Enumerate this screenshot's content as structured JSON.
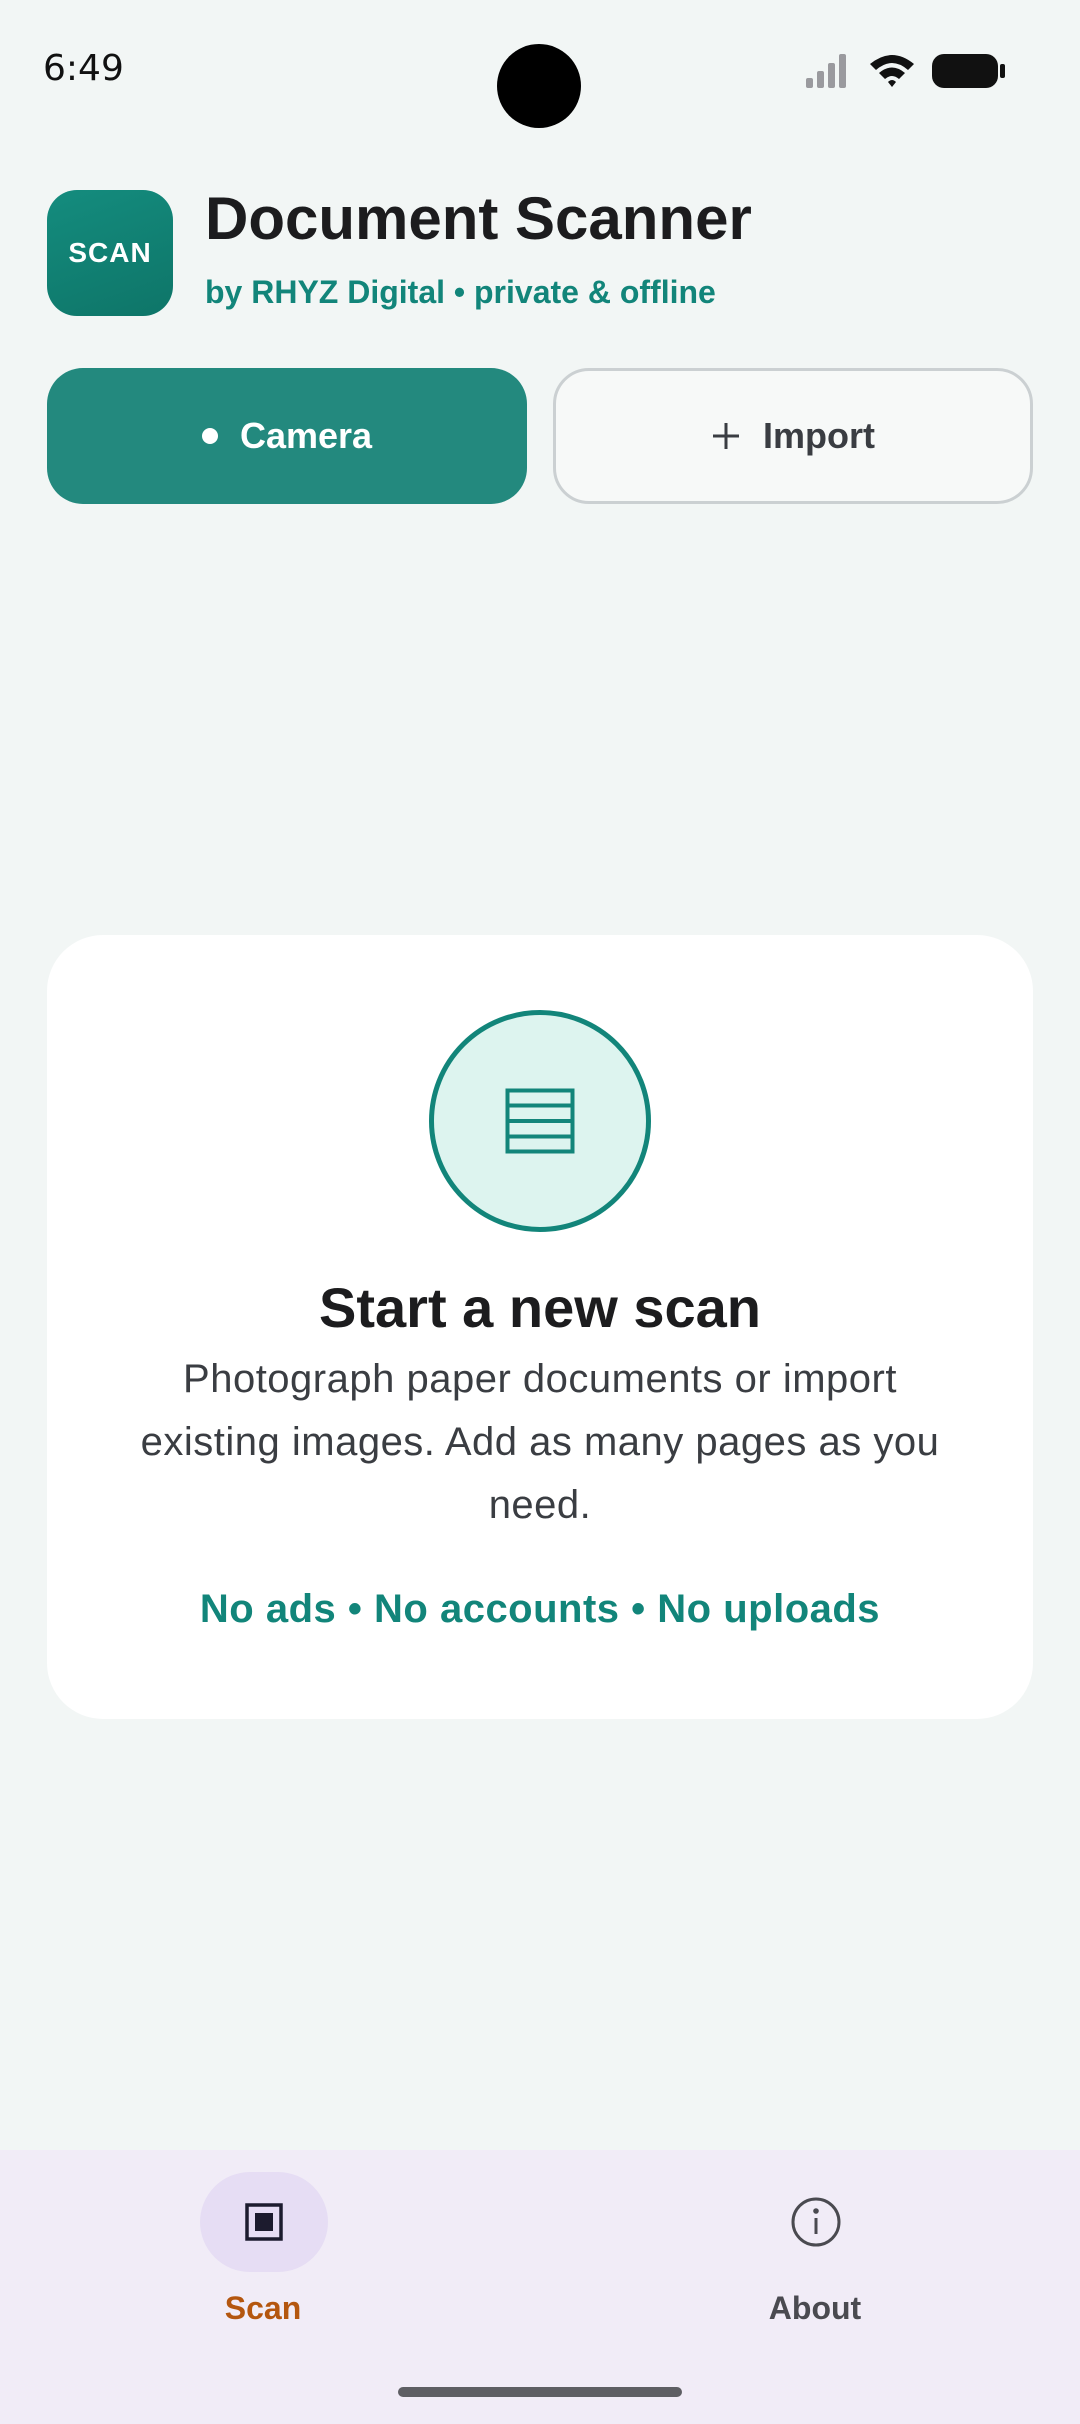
{
  "status_bar": {
    "time": "6:49"
  },
  "header": {
    "logo_text": "SCAN",
    "title": "Document Scanner",
    "subtitle": "by RHYZ Digital • private & offline"
  },
  "actions": {
    "camera_label": "Camera",
    "import_label": "Import"
  },
  "empty_state": {
    "icon": "scan-document-icon",
    "title": "Start a new scan",
    "description": "Photograph paper documents or import existing images. Add as many pages as you need.",
    "tags": "No ads • No accounts • No uploads"
  },
  "bottom_nav": {
    "items": [
      {
        "label": "Scan",
        "icon": "scan-square-icon",
        "active": true
      },
      {
        "label": "About",
        "icon": "info-icon",
        "active": false
      }
    ]
  },
  "colors": {
    "brand": "#12857A",
    "camera_button": "#23897E",
    "active_nav_label": "#B4560F",
    "background": "#F2F6F5",
    "nav_background": "#F1ECF7"
  }
}
